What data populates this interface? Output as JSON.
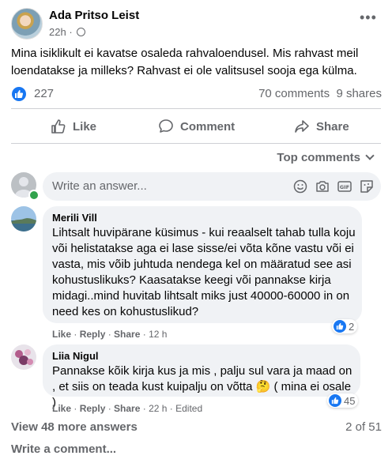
{
  "post": {
    "author": "Ada Pritso Leist",
    "time": "22h",
    "time_sep": "·",
    "text": "Mina isiklikult ei kavatse osaleda rahvaloendusel. Mis rahvast meil loendatakse ja milleks? Rahvast ei ole valitsusel sooja ega külma.",
    "reaction_count": "227",
    "comments_count": "70 comments",
    "shares_count": "9 shares",
    "more_icon": "more-horizontal-icon",
    "privacy_icon": "globe-icon"
  },
  "actions": {
    "like": "Like",
    "comment": "Comment",
    "share": "Share"
  },
  "sort": {
    "label": "Top comments"
  },
  "composer": {
    "placeholder": "Write an answer...",
    "icons": [
      "smiley-icon",
      "camera-icon",
      "gif-icon",
      "sticker-icon"
    ]
  },
  "comments": [
    {
      "name": "Merili Vill",
      "text": "Lihtsalt huvipärane küsimus - kui reaalselt tahab tulla koju või helistatakse aga ei lase sisse/ei võta kõne vastu või ei vasta, mis võib juhtuda nendega kel on määratud see asi kohustuslikuks? Kaasatakse keegi või pannakse kirja midagi..mind huvitab lihtsalt miks just 40000-60000 in on need kes on kohustuslikud?",
      "like": "Like",
      "reply": "Reply",
      "share": "Share",
      "time": "12 h",
      "edited": "",
      "reactions": "2"
    },
    {
      "name": "Liia Nigul",
      "text": "Pannakse kõik kirja kus ja mis , palju sul vara ja maad on , et siis on teada kust kuipalju on võtta",
      "emoji": "🤔",
      "text_end": " ( mina ei osale )",
      "like": "Like",
      "reply": "Reply",
      "share": "Share",
      "time": "22 h",
      "edited": "Edited",
      "reactions": "45"
    }
  ],
  "footer": {
    "view_more": "View 48 more answers",
    "pager": "2 of 51",
    "write_comment": "Write a comment..."
  },
  "colors": {
    "accent": "#1877f2",
    "muted": "#65676b",
    "bubble": "#f0f2f5",
    "online": "#31a24c"
  }
}
